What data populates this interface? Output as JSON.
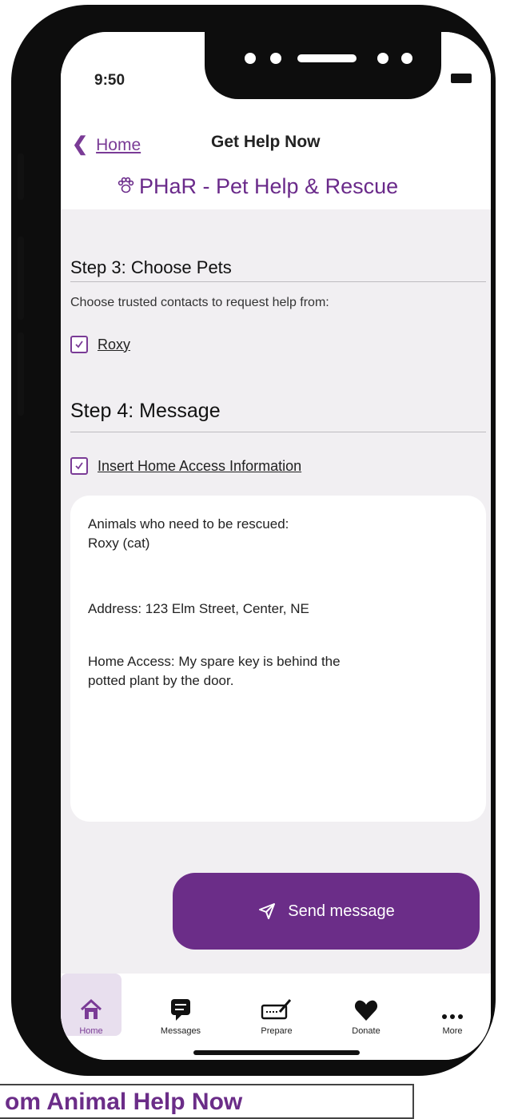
{
  "status_bar": {
    "time": "9:50"
  },
  "nav": {
    "back_label": "Home",
    "title": "Get Help Now"
  },
  "brand": {
    "name": "PHaR - Pet Help & Rescue"
  },
  "step3": {
    "title": "Step 3:  Choose Pets",
    "helper": "Choose trusted contacts to request help from:",
    "pets": [
      {
        "name": "Roxy",
        "checked": true
      }
    ]
  },
  "step4": {
    "title": "Step 4: Message",
    "insert_label": "Insert Home Access Information",
    "insert_checked": true,
    "message_lines": [
      "Animals who need to be rescued:",
      "Roxy (cat)",
      "Address: 123 Elm Street, Center, NE",
      "Home Access: My spare key is behind the",
      "potted plant by the door."
    ]
  },
  "send_button": {
    "label": "Send message"
  },
  "tabbar": {
    "items": [
      {
        "label": "Home",
        "icon": "house-icon",
        "active": true
      },
      {
        "label": "Messages",
        "icon": "chat-bubble-icon",
        "active": false
      },
      {
        "label": "Prepare",
        "icon": "keyboard-pencil-icon",
        "active": false
      },
      {
        "label": "Donate",
        "icon": "heart-icon",
        "active": false
      },
      {
        "label": "More",
        "icon": "ellipsis-icon",
        "active": false
      }
    ]
  },
  "banner": {
    "text": "om Animal Help Now"
  },
  "colors": {
    "accent": "#6b2d88",
    "screen_bg": "#f1eff2",
    "phone_frame": "#0d0d0d"
  }
}
